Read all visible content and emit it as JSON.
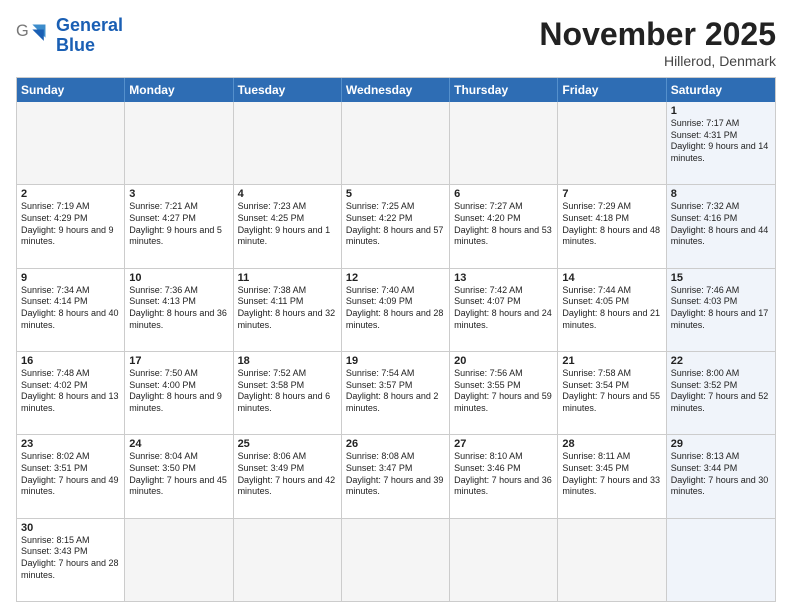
{
  "header": {
    "logo_general": "General",
    "logo_blue": "Blue",
    "month_title": "November 2025",
    "location": "Hillerod, Denmark"
  },
  "days_of_week": [
    "Sunday",
    "Monday",
    "Tuesday",
    "Wednesday",
    "Thursday",
    "Friday",
    "Saturday"
  ],
  "rows": [
    [
      {
        "day": "",
        "info": "",
        "empty": true,
        "weekend": false
      },
      {
        "day": "",
        "info": "",
        "empty": true,
        "weekend": false
      },
      {
        "day": "",
        "info": "",
        "empty": true,
        "weekend": false
      },
      {
        "day": "",
        "info": "",
        "empty": true,
        "weekend": false
      },
      {
        "day": "",
        "info": "",
        "empty": true,
        "weekend": false
      },
      {
        "day": "",
        "info": "",
        "empty": true,
        "weekend": false
      },
      {
        "day": "1",
        "info": "Sunrise: 7:17 AM\nSunset: 4:31 PM\nDaylight: 9 hours and 14 minutes.",
        "empty": false,
        "weekend": true
      }
    ],
    [
      {
        "day": "2",
        "info": "Sunrise: 7:19 AM\nSunset: 4:29 PM\nDaylight: 9 hours and 9 minutes.",
        "empty": false,
        "weekend": false
      },
      {
        "day": "3",
        "info": "Sunrise: 7:21 AM\nSunset: 4:27 PM\nDaylight: 9 hours and 5 minutes.",
        "empty": false,
        "weekend": false
      },
      {
        "day": "4",
        "info": "Sunrise: 7:23 AM\nSunset: 4:25 PM\nDaylight: 9 hours and 1 minute.",
        "empty": false,
        "weekend": false
      },
      {
        "day": "5",
        "info": "Sunrise: 7:25 AM\nSunset: 4:22 PM\nDaylight: 8 hours and 57 minutes.",
        "empty": false,
        "weekend": false
      },
      {
        "day": "6",
        "info": "Sunrise: 7:27 AM\nSunset: 4:20 PM\nDaylight: 8 hours and 53 minutes.",
        "empty": false,
        "weekend": false
      },
      {
        "day": "7",
        "info": "Sunrise: 7:29 AM\nSunset: 4:18 PM\nDaylight: 8 hours and 48 minutes.",
        "empty": false,
        "weekend": false
      },
      {
        "day": "8",
        "info": "Sunrise: 7:32 AM\nSunset: 4:16 PM\nDaylight: 8 hours and 44 minutes.",
        "empty": false,
        "weekend": true
      }
    ],
    [
      {
        "day": "9",
        "info": "Sunrise: 7:34 AM\nSunset: 4:14 PM\nDaylight: 8 hours and 40 minutes.",
        "empty": false,
        "weekend": false
      },
      {
        "day": "10",
        "info": "Sunrise: 7:36 AM\nSunset: 4:13 PM\nDaylight: 8 hours and 36 minutes.",
        "empty": false,
        "weekend": false
      },
      {
        "day": "11",
        "info": "Sunrise: 7:38 AM\nSunset: 4:11 PM\nDaylight: 8 hours and 32 minutes.",
        "empty": false,
        "weekend": false
      },
      {
        "day": "12",
        "info": "Sunrise: 7:40 AM\nSunset: 4:09 PM\nDaylight: 8 hours and 28 minutes.",
        "empty": false,
        "weekend": false
      },
      {
        "day": "13",
        "info": "Sunrise: 7:42 AM\nSunset: 4:07 PM\nDaylight: 8 hours and 24 minutes.",
        "empty": false,
        "weekend": false
      },
      {
        "day": "14",
        "info": "Sunrise: 7:44 AM\nSunset: 4:05 PM\nDaylight: 8 hours and 21 minutes.",
        "empty": false,
        "weekend": false
      },
      {
        "day": "15",
        "info": "Sunrise: 7:46 AM\nSunset: 4:03 PM\nDaylight: 8 hours and 17 minutes.",
        "empty": false,
        "weekend": true
      }
    ],
    [
      {
        "day": "16",
        "info": "Sunrise: 7:48 AM\nSunset: 4:02 PM\nDaylight: 8 hours and 13 minutes.",
        "empty": false,
        "weekend": false
      },
      {
        "day": "17",
        "info": "Sunrise: 7:50 AM\nSunset: 4:00 PM\nDaylight: 8 hours and 9 minutes.",
        "empty": false,
        "weekend": false
      },
      {
        "day": "18",
        "info": "Sunrise: 7:52 AM\nSunset: 3:58 PM\nDaylight: 8 hours and 6 minutes.",
        "empty": false,
        "weekend": false
      },
      {
        "day": "19",
        "info": "Sunrise: 7:54 AM\nSunset: 3:57 PM\nDaylight: 8 hours and 2 minutes.",
        "empty": false,
        "weekend": false
      },
      {
        "day": "20",
        "info": "Sunrise: 7:56 AM\nSunset: 3:55 PM\nDaylight: 7 hours and 59 minutes.",
        "empty": false,
        "weekend": false
      },
      {
        "day": "21",
        "info": "Sunrise: 7:58 AM\nSunset: 3:54 PM\nDaylight: 7 hours and 55 minutes.",
        "empty": false,
        "weekend": false
      },
      {
        "day": "22",
        "info": "Sunrise: 8:00 AM\nSunset: 3:52 PM\nDaylight: 7 hours and 52 minutes.",
        "empty": false,
        "weekend": true
      }
    ],
    [
      {
        "day": "23",
        "info": "Sunrise: 8:02 AM\nSunset: 3:51 PM\nDaylight: 7 hours and 49 minutes.",
        "empty": false,
        "weekend": false
      },
      {
        "day": "24",
        "info": "Sunrise: 8:04 AM\nSunset: 3:50 PM\nDaylight: 7 hours and 45 minutes.",
        "empty": false,
        "weekend": false
      },
      {
        "day": "25",
        "info": "Sunrise: 8:06 AM\nSunset: 3:49 PM\nDaylight: 7 hours and 42 minutes.",
        "empty": false,
        "weekend": false
      },
      {
        "day": "26",
        "info": "Sunrise: 8:08 AM\nSunset: 3:47 PM\nDaylight: 7 hours and 39 minutes.",
        "empty": false,
        "weekend": false
      },
      {
        "day": "27",
        "info": "Sunrise: 8:10 AM\nSunset: 3:46 PM\nDaylight: 7 hours and 36 minutes.",
        "empty": false,
        "weekend": false
      },
      {
        "day": "28",
        "info": "Sunrise: 8:11 AM\nSunset: 3:45 PM\nDaylight: 7 hours and 33 minutes.",
        "empty": false,
        "weekend": false
      },
      {
        "day": "29",
        "info": "Sunrise: 8:13 AM\nSunset: 3:44 PM\nDaylight: 7 hours and 30 minutes.",
        "empty": false,
        "weekend": true
      }
    ],
    [
      {
        "day": "30",
        "info": "Sunrise: 8:15 AM\nSunset: 3:43 PM\nDaylight: 7 hours and 28 minutes.",
        "empty": false,
        "weekend": false
      },
      {
        "day": "",
        "info": "",
        "empty": true,
        "weekend": false
      },
      {
        "day": "",
        "info": "",
        "empty": true,
        "weekend": false
      },
      {
        "day": "",
        "info": "",
        "empty": true,
        "weekend": false
      },
      {
        "day": "",
        "info": "",
        "empty": true,
        "weekend": false
      },
      {
        "day": "",
        "info": "",
        "empty": true,
        "weekend": false
      },
      {
        "day": "",
        "info": "",
        "empty": true,
        "weekend": true
      }
    ]
  ]
}
